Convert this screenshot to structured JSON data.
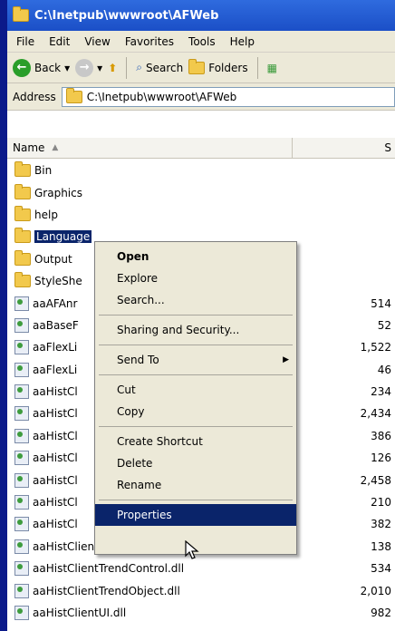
{
  "window": {
    "title": "C:\\Inetpub\\wwwroot\\AFWeb"
  },
  "menubar": [
    "File",
    "Edit",
    "View",
    "Favorites",
    "Tools",
    "Help"
  ],
  "toolbar": {
    "back_label": "Back",
    "search_label": "Search",
    "folders_label": "Folders"
  },
  "address": {
    "label": "Address",
    "value": "C:\\Inetpub\\wwwroot\\AFWeb"
  },
  "columns": {
    "name": "Name",
    "size": "S"
  },
  "files": [
    {
      "name": "Bin",
      "size": "",
      "type": "folder"
    },
    {
      "name": "Graphics",
      "size": "",
      "type": "folder"
    },
    {
      "name": "help",
      "size": "",
      "type": "folder"
    },
    {
      "name": "Language",
      "size": "",
      "type": "folder",
      "selected": true
    },
    {
      "name": "Output",
      "size": "",
      "type": "folder"
    },
    {
      "name": "StyleShe",
      "size": "",
      "type": "folder"
    },
    {
      "name": "aaAFAnr",
      "size": "514",
      "type": "dll"
    },
    {
      "name": "aaBaseF",
      "size": "52",
      "type": "dll"
    },
    {
      "name": "aaFlexLi",
      "size": "1,522",
      "type": "dll"
    },
    {
      "name": "aaFlexLi",
      "size": "46",
      "type": "dll"
    },
    {
      "name": "aaHistCl",
      "size": "234",
      "type": "dll"
    },
    {
      "name": "aaHistCl",
      "size": "2,434",
      "type": "dll"
    },
    {
      "name": "aaHistCl",
      "size": "386",
      "type": "dll"
    },
    {
      "name": "aaHistCl",
      "size": "126",
      "type": "dll"
    },
    {
      "name": "aaHistCl",
      "size": "2,458",
      "type": "dll"
    },
    {
      "name": "aaHistCl",
      "size": "210",
      "type": "dll"
    },
    {
      "name": "aaHistCl",
      "size": "382",
      "type": "dll"
    },
    {
      "name": "aaHistClientTimeRangePicker.dll",
      "size": "138",
      "type": "dll"
    },
    {
      "name": "aaHistClientTrendControl.dll",
      "size": "534",
      "type": "dll"
    },
    {
      "name": "aaHistClientTrendObject.dll",
      "size": "2,010",
      "type": "dll"
    },
    {
      "name": "aaHistClientUI.dll",
      "size": "982",
      "type": "dll"
    }
  ],
  "context_menu": [
    {
      "label": "Open",
      "bold": true
    },
    {
      "label": "Explore"
    },
    {
      "label": "Search..."
    },
    {
      "separator": true
    },
    {
      "label": "Sharing and Security..."
    },
    {
      "separator": true
    },
    {
      "label": "Send To",
      "submenu": true
    },
    {
      "separator": true
    },
    {
      "label": "Cut"
    },
    {
      "label": "Copy"
    },
    {
      "separator": true
    },
    {
      "label": "Create Shortcut"
    },
    {
      "label": "Delete"
    },
    {
      "label": "Rename"
    },
    {
      "separator": true
    },
    {
      "label": "Properties",
      "highlighted": true
    }
  ],
  "colors": {
    "titlebar": "#2f6bde",
    "selection": "#0a246a",
    "chrome": "#ece9d8"
  }
}
